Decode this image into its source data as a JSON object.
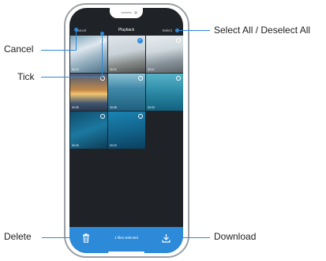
{
  "callouts": {
    "cancel": "Cancel",
    "tick": "Tick",
    "delete": "Delete",
    "select_all": "Select All / Deselect All",
    "download": "Download"
  },
  "header": {
    "cancel": "Cancel",
    "title": "Playback",
    "select": "Select"
  },
  "thumbnails": [
    {
      "duration": "00:13",
      "selected": false
    },
    {
      "duration": "00:22",
      "selected": true
    },
    {
      "duration": "00:11",
      "selected": false
    },
    {
      "duration": "00:05",
      "selected": false
    },
    {
      "duration": "00:08",
      "selected": false
    },
    {
      "duration": "00:03",
      "selected": false
    },
    {
      "duration": "00:25",
      "selected": false
    },
    {
      "duration": "00:23",
      "selected": false
    }
  ],
  "bottombar": {
    "selected_text": "1 files selected"
  },
  "colors": {
    "accent": "#2d8ad9",
    "screen_bg": "#1f2226"
  },
  "icons": {
    "delete": "trash-icon",
    "download": "download-icon",
    "tick": "check-icon"
  }
}
